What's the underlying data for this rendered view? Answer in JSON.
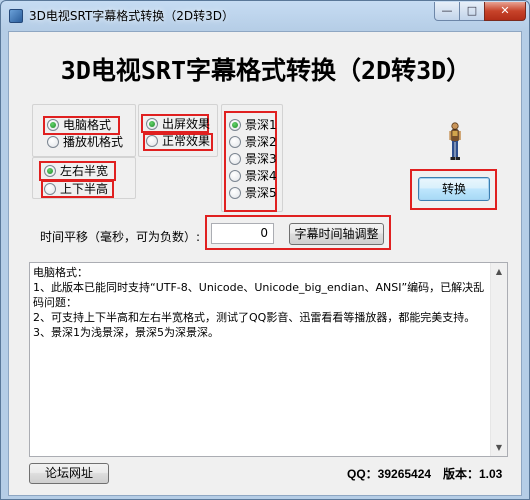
{
  "window": {
    "title": "3D电视SRT字幕格式转换（2D转3D）",
    "min_label": "—",
    "max_label": "□",
    "close_label": "✕"
  },
  "header": {
    "title": "3D电视SRT字幕格式转换（2D转3D）"
  },
  "format_group": {
    "options": [
      {
        "label": "电脑格式",
        "checked": true
      },
      {
        "label": "播放机格式",
        "checked": false
      }
    ]
  },
  "effect_group": {
    "options": [
      {
        "label": "出屏效果",
        "checked": true
      },
      {
        "label": "正常效果",
        "checked": false
      }
    ]
  },
  "layout_group": {
    "options": [
      {
        "label": "左右半宽",
        "checked": true
      },
      {
        "label": "上下半高",
        "checked": false
      }
    ]
  },
  "depth_group": {
    "options": [
      {
        "label": "景深1",
        "checked": true
      },
      {
        "label": "景深2",
        "checked": false
      },
      {
        "label": "景深3",
        "checked": false
      },
      {
        "label": "景深4",
        "checked": false
      },
      {
        "label": "景深5",
        "checked": false
      }
    ]
  },
  "convert_button": "转换",
  "time_shift": {
    "label": "时间平移（毫秒，可为负数）:",
    "value": "0",
    "adjust_button": "字幕时间轴调整"
  },
  "info_text": {
    "lines": [
      "电脑格式：",
      "1、此版本已能同时支持“UTF-8、Unicode、Unicode_big_endian、ANSI”编码，已解决乱码问题：",
      "2、可支持上下半高和左右半宽格式，测试了QQ影音、迅雷看看等播放器，都能完美支持。",
      "3、景深1为浅景深，景深5为深景深。"
    ]
  },
  "scrollbar": {
    "up": "▲",
    "down": "▼"
  },
  "footer": {
    "forum_button": "论坛网址",
    "qq": "QQ：39265424",
    "version": "版本：1.03"
  }
}
